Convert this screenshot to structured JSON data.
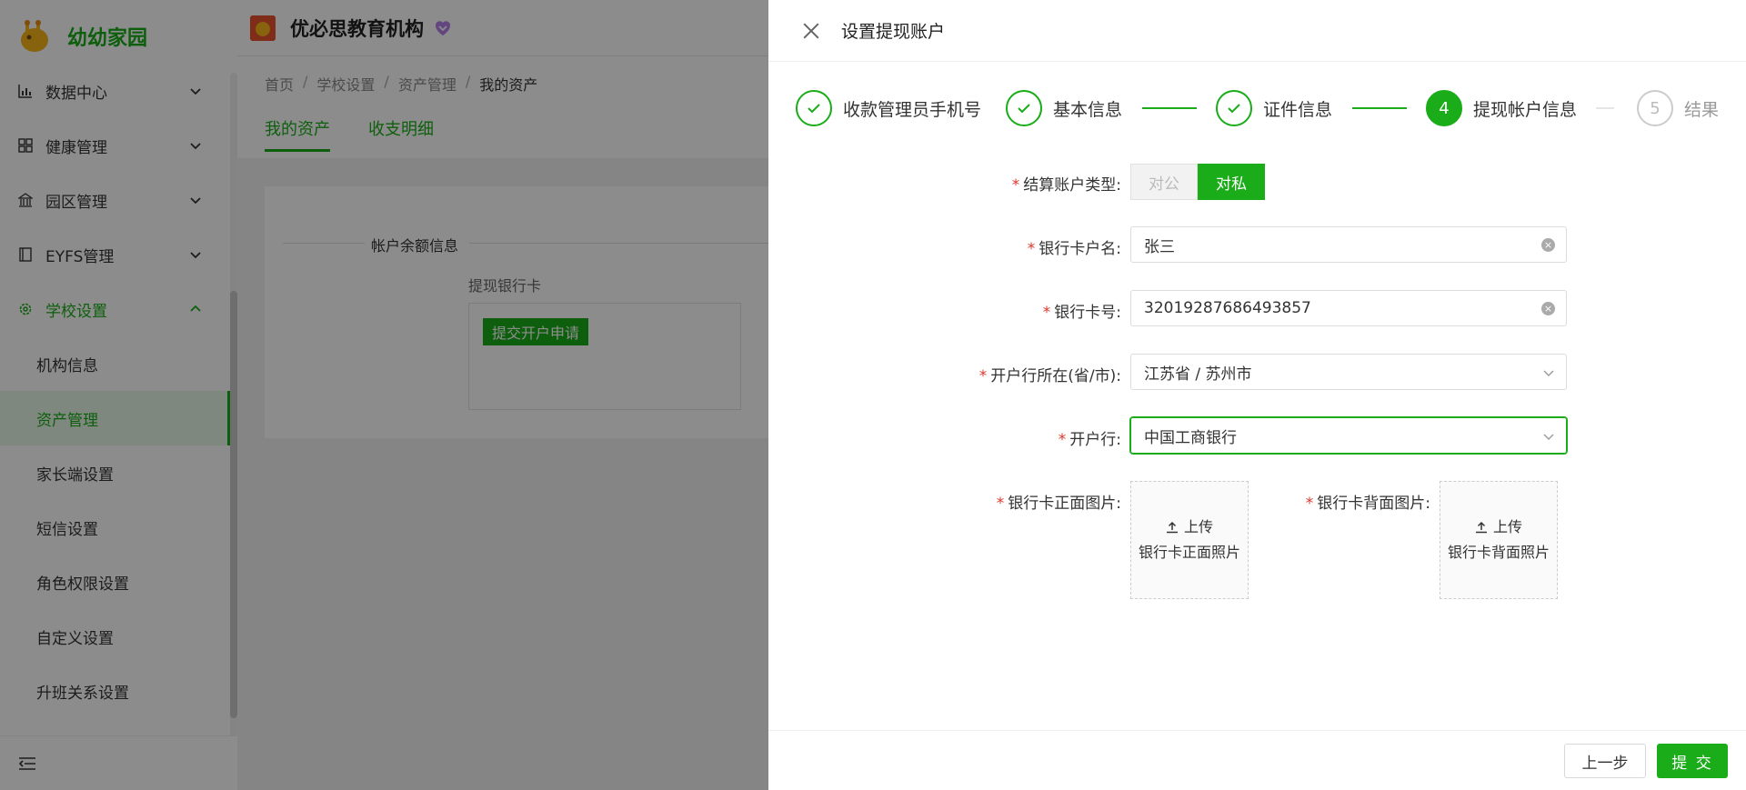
{
  "app": {
    "name": "幼幼家园"
  },
  "sidebar": {
    "items": [
      {
        "label": "数据中心",
        "icon": "bar-chart-icon"
      },
      {
        "label": "健康管理",
        "icon": "grid-icon"
      },
      {
        "label": "园区管理",
        "icon": "building-icon"
      },
      {
        "label": "EYFS管理",
        "icon": "book-icon"
      },
      {
        "label": "学校设置",
        "icon": "gear-icon"
      }
    ],
    "subitems": [
      {
        "label": "机构信息"
      },
      {
        "label": "资产管理"
      },
      {
        "label": "家长端设置"
      },
      {
        "label": "短信设置"
      },
      {
        "label": "角色权限设置"
      },
      {
        "label": "自定义设置"
      },
      {
        "label": "升班关系设置"
      }
    ]
  },
  "topbar": {
    "org_name": "优必思教育机构"
  },
  "breadcrumb": [
    "首页",
    "学校设置",
    "资产管理",
    "我的资产"
  ],
  "tabs": [
    "我的资产",
    "收支明细"
  ],
  "card": {
    "title": "帐户余额信息",
    "bank_label": "提现银行卡",
    "apply_button": "提交开户申请"
  },
  "drawer": {
    "title": "设置提现账户",
    "steps": [
      {
        "label": "收款管理员手机号",
        "status": "done"
      },
      {
        "label": "基本信息",
        "status": "done"
      },
      {
        "label": "证件信息",
        "status": "done"
      },
      {
        "label": "提现帐户信息",
        "status": "current",
        "number": "4"
      },
      {
        "label": "结果",
        "status": "pending",
        "number": "5"
      }
    ],
    "form": {
      "account_type": {
        "label": "结算账户类型:",
        "options": [
          "对公",
          "对私"
        ],
        "selected": "对私"
      },
      "card_name": {
        "label": "银行卡户名:",
        "value": "张三"
      },
      "card_number": {
        "label": "银行卡号:",
        "value": "32019287686493857"
      },
      "bank_location": {
        "label": "开户行所在(省/市):",
        "value": "江苏省 / 苏州市"
      },
      "bank": {
        "label": "开户行:",
        "value": "中国工商银行"
      },
      "front_image": {
        "label": "银行卡正面图片:",
        "upload": "上传",
        "hint": "银行卡正面照片"
      },
      "back_image": {
        "label": "银行卡背面图片:",
        "upload": "上传",
        "hint": "银行卡背面照片"
      }
    },
    "footer": {
      "prev": "上一步",
      "submit": "提 交"
    }
  },
  "colors": {
    "accent": "#1aad19",
    "required": "#e0352b"
  }
}
